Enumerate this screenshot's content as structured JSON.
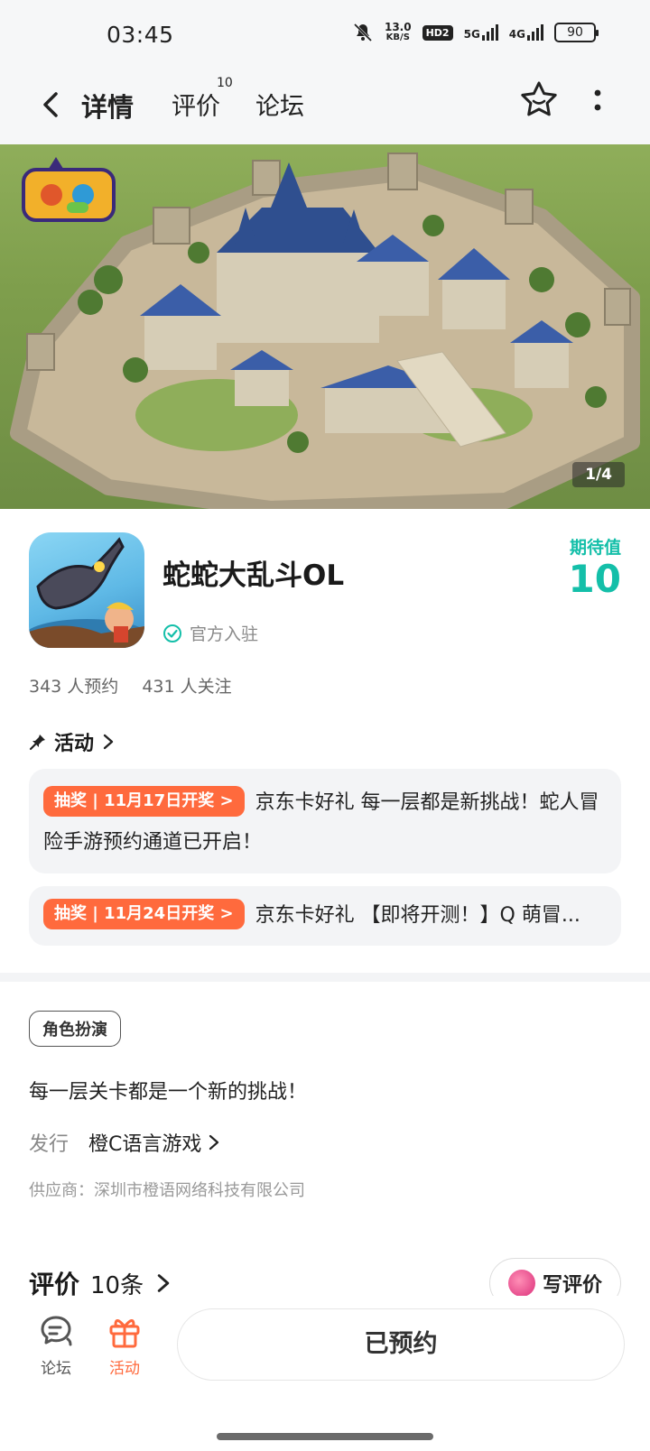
{
  "status_bar": {
    "time": "03:45",
    "net_speed_value": "13.0",
    "net_speed_unit": "KB/S",
    "hd": "HD2",
    "net1": "5G",
    "net2": "4G",
    "battery": "90"
  },
  "nav": {
    "tab_detail": "详情",
    "tab_review": "评价",
    "tab_review_badge": "10",
    "tab_forum": "论坛"
  },
  "banner": {
    "counter": "1/4"
  },
  "app": {
    "name": "蛇蛇大乱斗OL",
    "official": "官方入驻",
    "expect_label": "期待值",
    "expect_value": "10",
    "reservations": "343 人预约",
    "follows": "431 人关注"
  },
  "activities": {
    "header": "活动",
    "items": [
      {
        "tag": "抽奖 | 11月17日开奖 >",
        "text": "京东卡好礼 每一层都是新挑战！蛇人冒险手游预约通道已开启！"
      },
      {
        "tag": "抽奖 | 11月24日开奖 >",
        "text": "京东卡好礼 【即将开测！】Q 萌冒..."
      }
    ]
  },
  "info": {
    "genre": "角色扮演",
    "description": "每一层关卡都是一个新的挑战！",
    "publisher_label": "发行",
    "publisher_name": "橙C语言游戏",
    "supplier": "供应商：深圳市橙语网络科技有限公司"
  },
  "reviews": {
    "title": "评价",
    "count": "10条",
    "write_label": "写评价"
  },
  "bottom_bar": {
    "forum_label": "论坛",
    "activity_label": "活动",
    "reserved_label": "已预约"
  },
  "colors": {
    "accent_teal": "#1fc8b4",
    "accent_orange": "#ff6a3d",
    "banner_green": "#7e9e4c"
  }
}
